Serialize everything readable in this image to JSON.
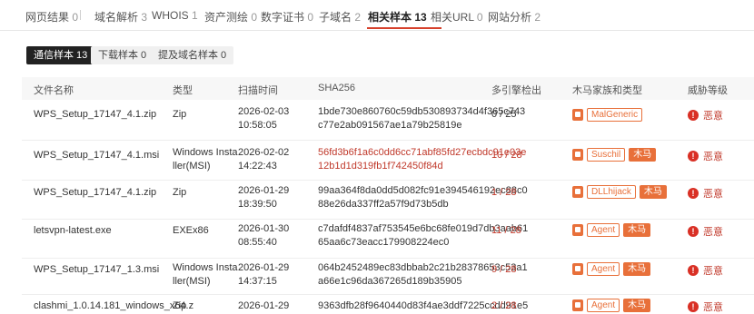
{
  "tabs": [
    {
      "label": "网页结果",
      "count": "0"
    },
    {
      "label": "域名解析",
      "count": "3"
    },
    {
      "label": "WHOIS",
      "count": "1"
    },
    {
      "label": "资产测绘",
      "count": "0"
    },
    {
      "label": "数字证书",
      "count": "0"
    },
    {
      "label": "子域名",
      "count": "2"
    },
    {
      "label": "相关样本",
      "count": "13"
    },
    {
      "label": "相关URL",
      "count": "0"
    },
    {
      "label": "网站分析",
      "count": "2"
    }
  ],
  "subtabs": [
    {
      "label": "通信样本 13"
    },
    {
      "label": "下载样本 0"
    },
    {
      "label": "提及域名样本 0"
    }
  ],
  "table": {
    "headers": {
      "name": "文件名称",
      "type": "类型",
      "time": "扫描时间",
      "sha": "SHA256",
      "detect": "多引擎检出",
      "family": "木马家族和类型",
      "threat": "威胁等级"
    },
    "rows": [
      {
        "name": "WPS_Setup_17147_4.1.zip",
        "type": [
          "Zip"
        ],
        "time": [
          "2026-02-03",
          "10:58:05"
        ],
        "sha": [
          "1bde730e860760c59db530893734d4f365c743",
          "c77e2ab091567ae1a79b25819e"
        ],
        "detect": "0 / 25",
        "family": "MalGeneric",
        "ttype": "",
        "threat": "恶意"
      },
      {
        "name": "WPS_Setup_17147_4.1.msi",
        "type": [
          "Windows Insta",
          "ller(MSI)"
        ],
        "time": [
          "2026-02-02",
          "14:22:43"
        ],
        "sha": [
          "56fd3b6f1a6c0dd6cc71abf85fd27ecbdc91e03e",
          "12b1d1d319fb1f742450f84d"
        ],
        "detect": "10 / 28",
        "family": "Suschil",
        "ttype": "木马",
        "threat": "恶意"
      },
      {
        "name": "WPS_Setup_17147_4.1.zip",
        "type": [
          "Zip"
        ],
        "time": [
          "2026-01-29",
          "18:39:50"
        ],
        "sha": [
          "99aa364f8da0dd5d082fc91e394546192ec88c0",
          "88e26da337ff2a57f9d73b5db"
        ],
        "detect": "1 / 28",
        "family": "DLLhijack",
        "ttype": "木马",
        "threat": "恶意"
      },
      {
        "name": "letsvpn-latest.exe",
        "type": [
          "EXEx86"
        ],
        "time": [
          "2026-01-30",
          "08:55:40"
        ],
        "sha": [
          "c7dafdf4837af753545e6bc68fe019d7db3aab61",
          "65aa6c73eacc179908224ec0"
        ],
        "detect": "11 / 28",
        "family": "Agent",
        "ttype": "木马",
        "threat": "恶意"
      },
      {
        "name": "WPS_Setup_17147_1.3.msi",
        "type": [
          "Windows Insta",
          "ller(MSI)"
        ],
        "time": [
          "2026-01-29",
          "14:37:15"
        ],
        "sha": [
          "064b2452489ec83dbbab2c21b28378653c53a1",
          "a66e1c96da367265d189b35905"
        ],
        "detect": "9 / 28",
        "family": "Agent",
        "ttype": "木马",
        "threat": "恶意"
      },
      {
        "name": "clashmi_1.0.14.181_windows_x64.z",
        "type": [
          "Zip"
        ],
        "time": [
          "2026-01-29",
          ""
        ],
        "sha": [
          "9363dfb28f9640440d83f4ae3ddf7225ccdd91e5",
          ""
        ],
        "detect": "2 / 28",
        "family": "Agent",
        "ttype": "木马",
        "threat": "恶意"
      }
    ]
  },
  "colors": {
    "accent": "#d6402b",
    "danger": "#d93025",
    "trojan": "#e8703a"
  }
}
